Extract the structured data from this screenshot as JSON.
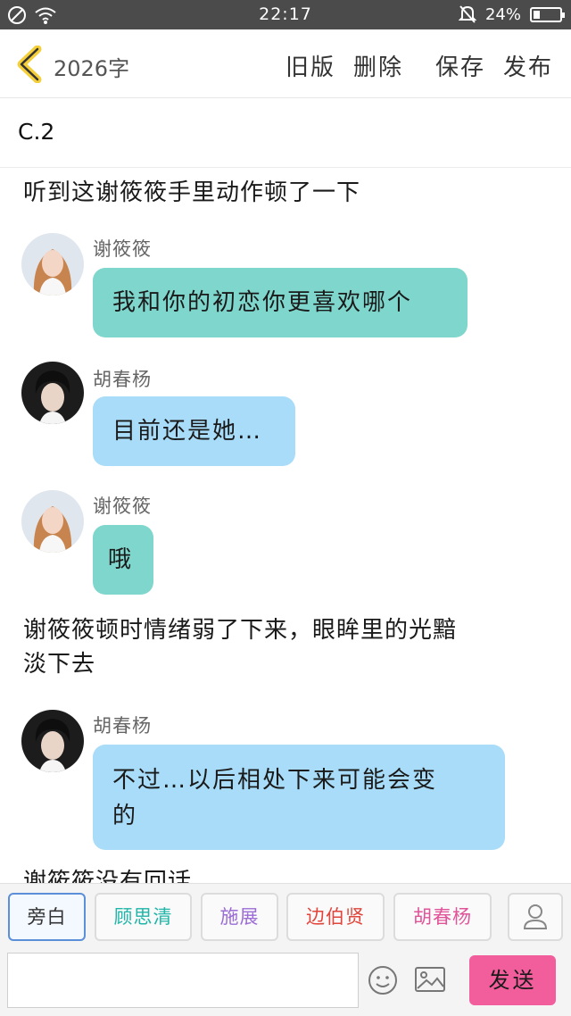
{
  "status_bar": {
    "time": "22:17",
    "battery": "24%",
    "battery_level": 0.24
  },
  "header": {
    "word_count": "2026字",
    "actions": {
      "old_version": "旧版",
      "delete": "删除",
      "save": "保存",
      "publish": "发布"
    }
  },
  "chapter_title": "C.2",
  "content": {
    "narration_1": "听到这谢筱筱手里动作顿了一下",
    "msg_1": {
      "speaker": "谢筱筱",
      "text": "我和你的初恋你更喜欢哪个"
    },
    "msg_2": {
      "speaker": "胡春杨",
      "text": "目前还是她…"
    },
    "msg_3": {
      "speaker": "谢筱筱",
      "text": "哦"
    },
    "narration_2_line1": "谢筱筱顿时情绪弱了下来，眼眸里的光黯",
    "narration_2_line2": "淡下去",
    "msg_4": {
      "speaker": "胡春杨",
      "text_line1": "不过…以后相处下来可能会变",
      "text_line2": "的"
    },
    "narration_3_partial": "谢筱筱没有回话"
  },
  "roles": [
    {
      "label": "旁白",
      "color": "#333333"
    },
    {
      "label": "顾思清",
      "color": "#1fb5a8"
    },
    {
      "label": "施展",
      "color": "#9b6cd6"
    },
    {
      "label": "边伯贤",
      "color": "#e0463c"
    },
    {
      "label": "胡春杨",
      "color": "#e0559a"
    }
  ],
  "input": {
    "placeholder": "",
    "send_label": "发送"
  }
}
